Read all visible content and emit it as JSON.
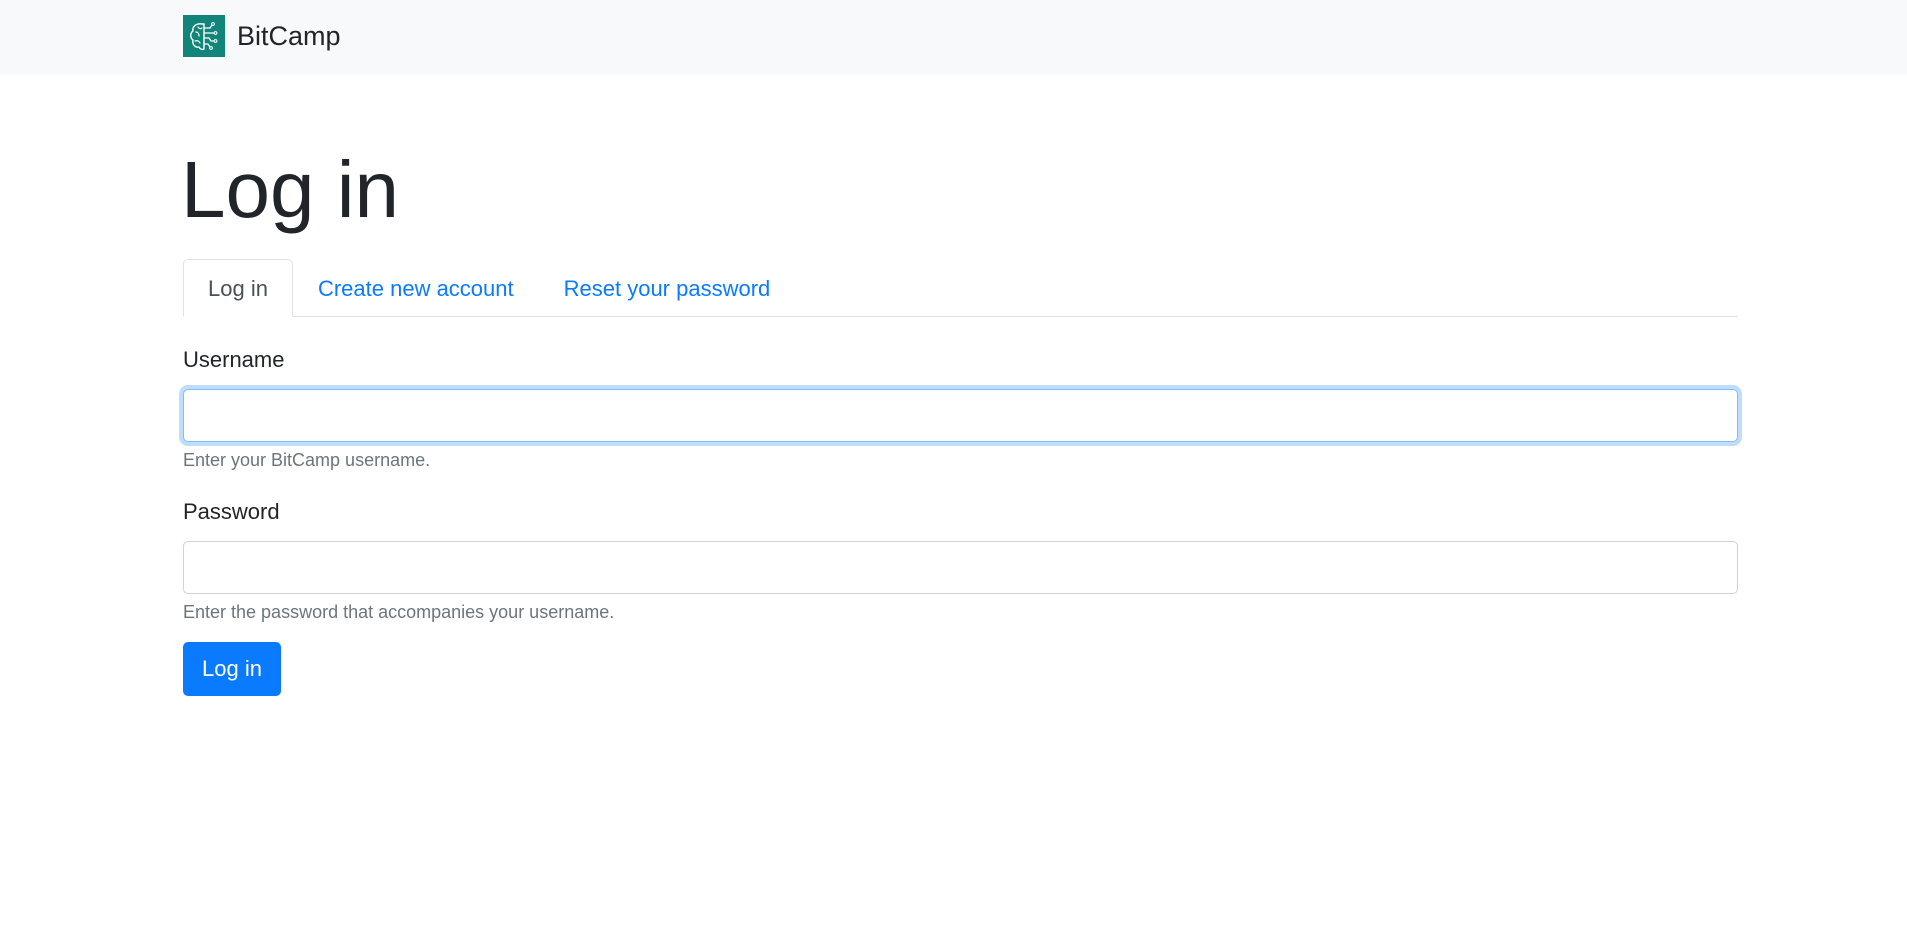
{
  "header": {
    "brand_name": "BitCamp",
    "logo_icon": "bitcamp-brain-circuit-logo",
    "logo_color": "#11857a"
  },
  "page": {
    "title": "Log in"
  },
  "tabs": [
    {
      "label": "Log in",
      "active": true
    },
    {
      "label": "Create new account",
      "active": false
    },
    {
      "label": "Reset your password",
      "active": false
    }
  ],
  "form": {
    "username": {
      "label": "Username",
      "value": "",
      "help": "Enter your BitCamp username."
    },
    "password": {
      "label": "Password",
      "value": "",
      "help": "Enter the password that accompanies your username."
    },
    "submit_label": "Log in"
  },
  "colors": {
    "link": "#0a7bff",
    "button": "#0a7bff",
    "navbar_bg": "#f8f9fa",
    "focus_ring": "#80bdff"
  }
}
